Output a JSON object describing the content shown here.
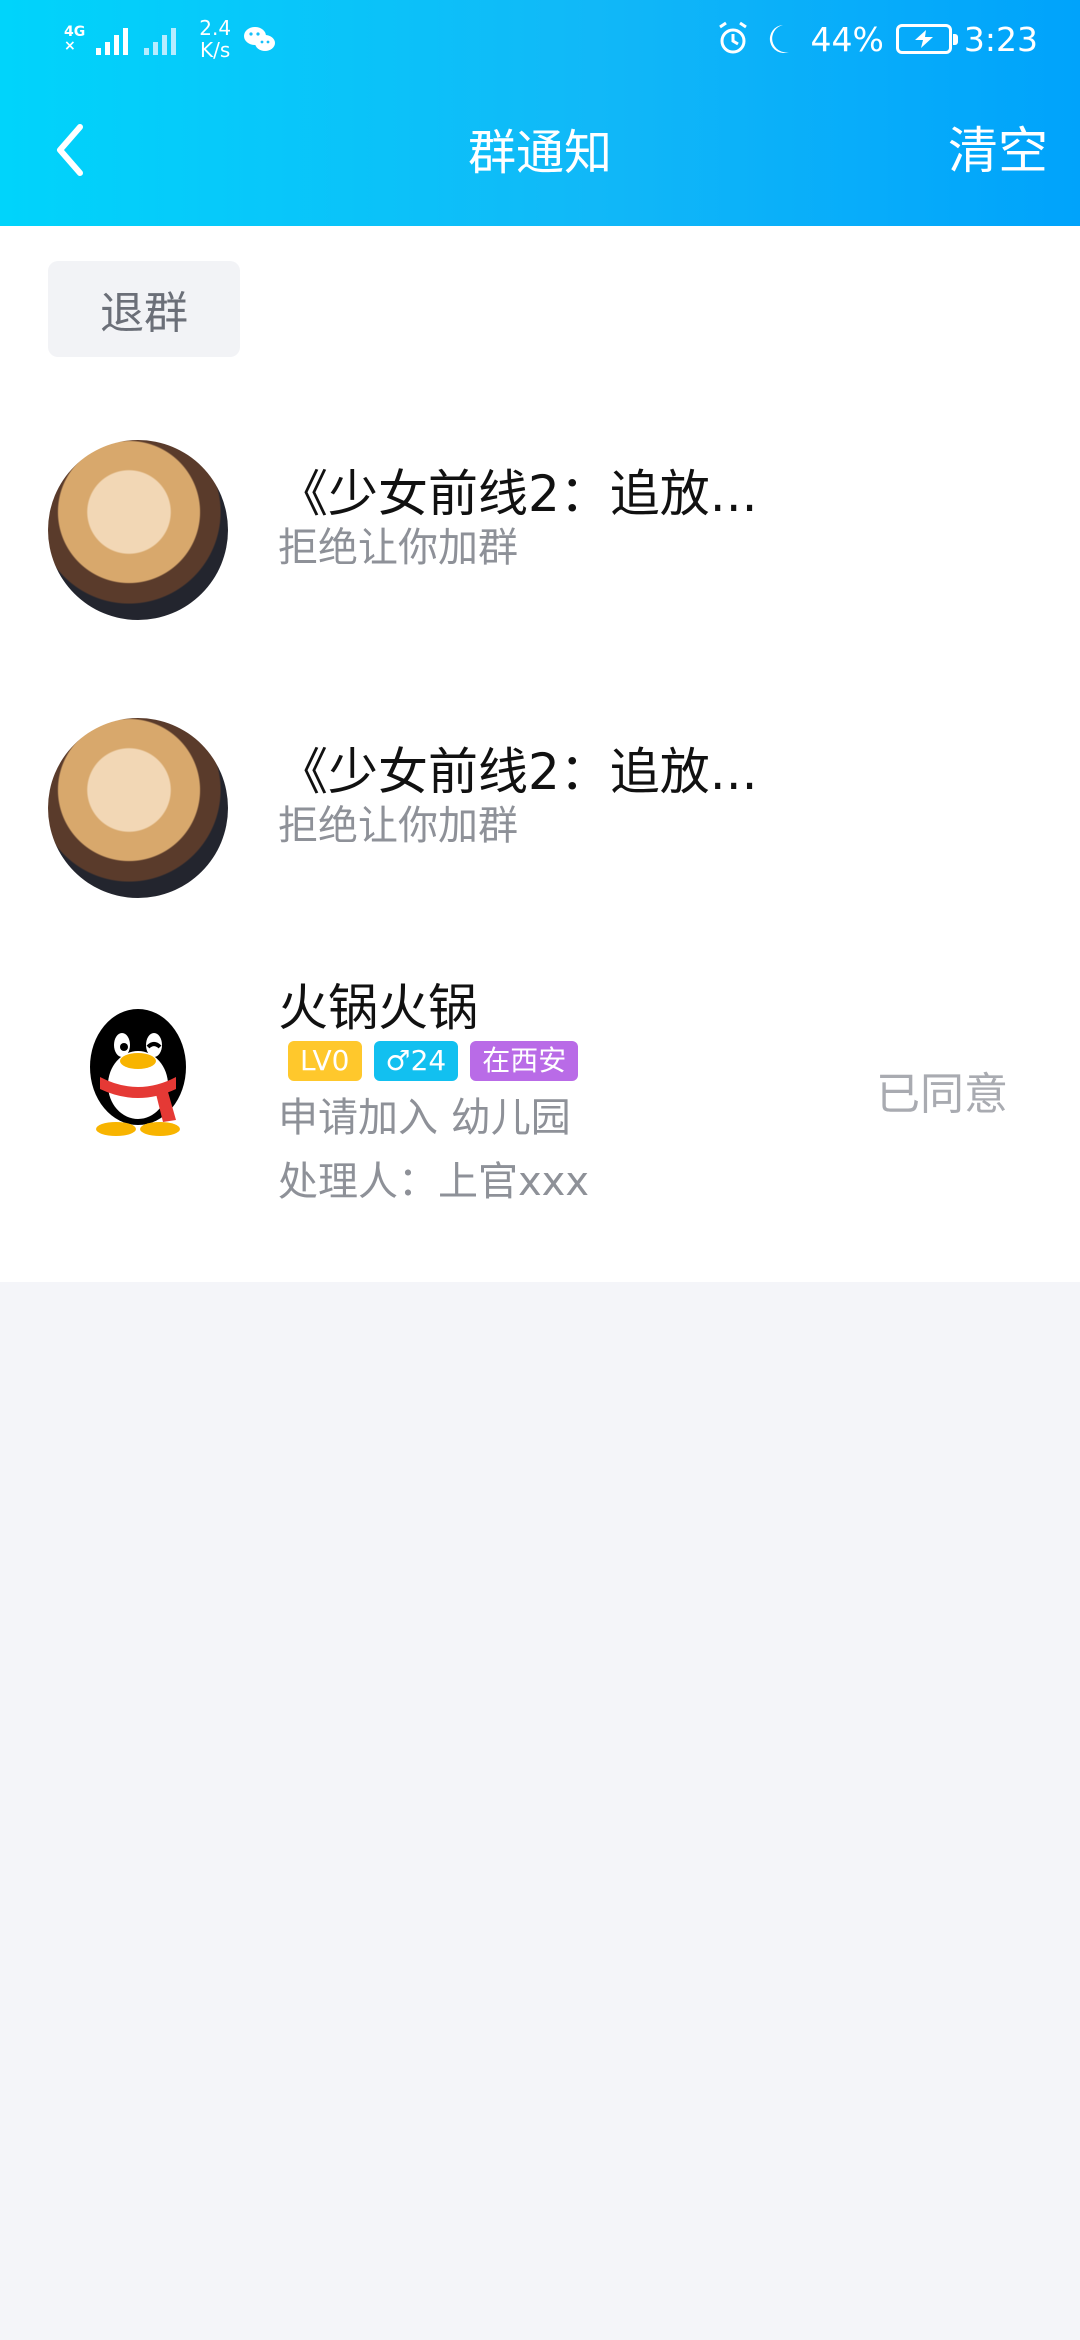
{
  "status_bar": {
    "network_labels": [
      "4G",
      "×"
    ],
    "speed_value": "2.4",
    "speed_unit": "K/s",
    "left_icons": [
      "signal-icon",
      "signal-empty-icon",
      "wechat-icon"
    ],
    "right_icons": [
      "alarm-icon",
      "moon-icon",
      "battery-icon"
    ],
    "battery_percent": "44%",
    "time": "3:23"
  },
  "nav": {
    "title": "群通知",
    "back_icon": "chevron-left-icon",
    "clear_label": "清空"
  },
  "actions": {
    "quit_label": "退群"
  },
  "notifications": [
    {
      "name": "《少女前线2：追放...",
      "message": "拒绝让你加群",
      "avatar": "anime-avatar"
    },
    {
      "name": "《少女前线2：追放...",
      "message": "拒绝让你加群",
      "avatar": "anime-avatar"
    },
    {
      "name": "火锅火锅",
      "level": "LV0",
      "gender_age": "♂24",
      "location": "在西安",
      "request": "申请加入 幼儿园",
      "handler": "处理人：上官xxx",
      "status": "已同意",
      "avatar": "qq-penguin-avatar"
    }
  ],
  "colors": {
    "header_start": "#00d4fb",
    "header_end": "#00a3fb",
    "page_background": "#f4f5f9",
    "tag_level": "#ffc82c",
    "tag_gender": "#12c0f0",
    "tag_location": "#b96be7"
  }
}
